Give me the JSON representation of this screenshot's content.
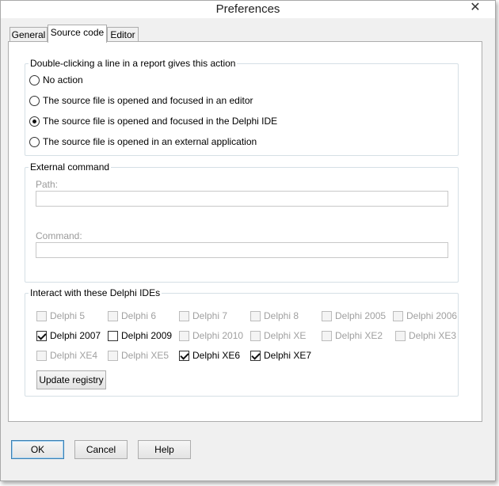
{
  "window": {
    "title": "Preferences",
    "close_label": "✕"
  },
  "tabs": [
    {
      "label": "General",
      "active": false
    },
    {
      "label": "Source code",
      "active": true
    },
    {
      "label": "Editor",
      "active": false
    }
  ],
  "action_group": {
    "label": "Double-clicking a line in a report gives this action",
    "options": [
      {
        "label": "No action",
        "selected": false
      },
      {
        "label": "The source file is opened and focused in an editor",
        "selected": false
      },
      {
        "label": "The source file is opened and focused in the Delphi IDE",
        "selected": true
      },
      {
        "label": "The source file is opened in an external application",
        "selected": false
      }
    ]
  },
  "external_command": {
    "label": "External command",
    "path_label": "Path:",
    "path_value": "",
    "command_label": "Command:",
    "command_value": ""
  },
  "ides": {
    "label": "Interact with these Delphi IDEs",
    "rows": [
      [
        {
          "label": "Delphi 5",
          "checked": false,
          "enabled": false
        },
        {
          "label": "Delphi 6",
          "checked": false,
          "enabled": false
        },
        {
          "label": "Delphi 7",
          "checked": false,
          "enabled": false
        },
        {
          "label": "Delphi 8",
          "checked": false,
          "enabled": false
        },
        {
          "label": "Delphi 2005",
          "checked": false,
          "enabled": false
        },
        {
          "label": "Delphi 2006",
          "checked": false,
          "enabled": false
        }
      ],
      [
        {
          "label": "Delphi 2007",
          "checked": true,
          "enabled": true
        },
        {
          "label": "Delphi 2009",
          "checked": false,
          "enabled": true
        },
        {
          "label": "Delphi 2010",
          "checked": false,
          "enabled": false
        },
        {
          "label": "Delphi XE",
          "checked": false,
          "enabled": false
        },
        {
          "label": "Delphi XE2",
          "checked": false,
          "enabled": false
        },
        {
          "label": "Delphi XE3",
          "checked": false,
          "enabled": false
        }
      ],
      [
        {
          "label": "Delphi XE4",
          "checked": false,
          "enabled": false
        },
        {
          "label": "Delphi XE5",
          "checked": false,
          "enabled": false
        },
        {
          "label": "Delphi XE6",
          "checked": true,
          "enabled": true
        },
        {
          "label": "Delphi XE7",
          "checked": true,
          "enabled": true
        }
      ]
    ],
    "update_button": "Update registry"
  },
  "buttons": {
    "ok": "OK",
    "cancel": "Cancel",
    "help": "Help"
  }
}
